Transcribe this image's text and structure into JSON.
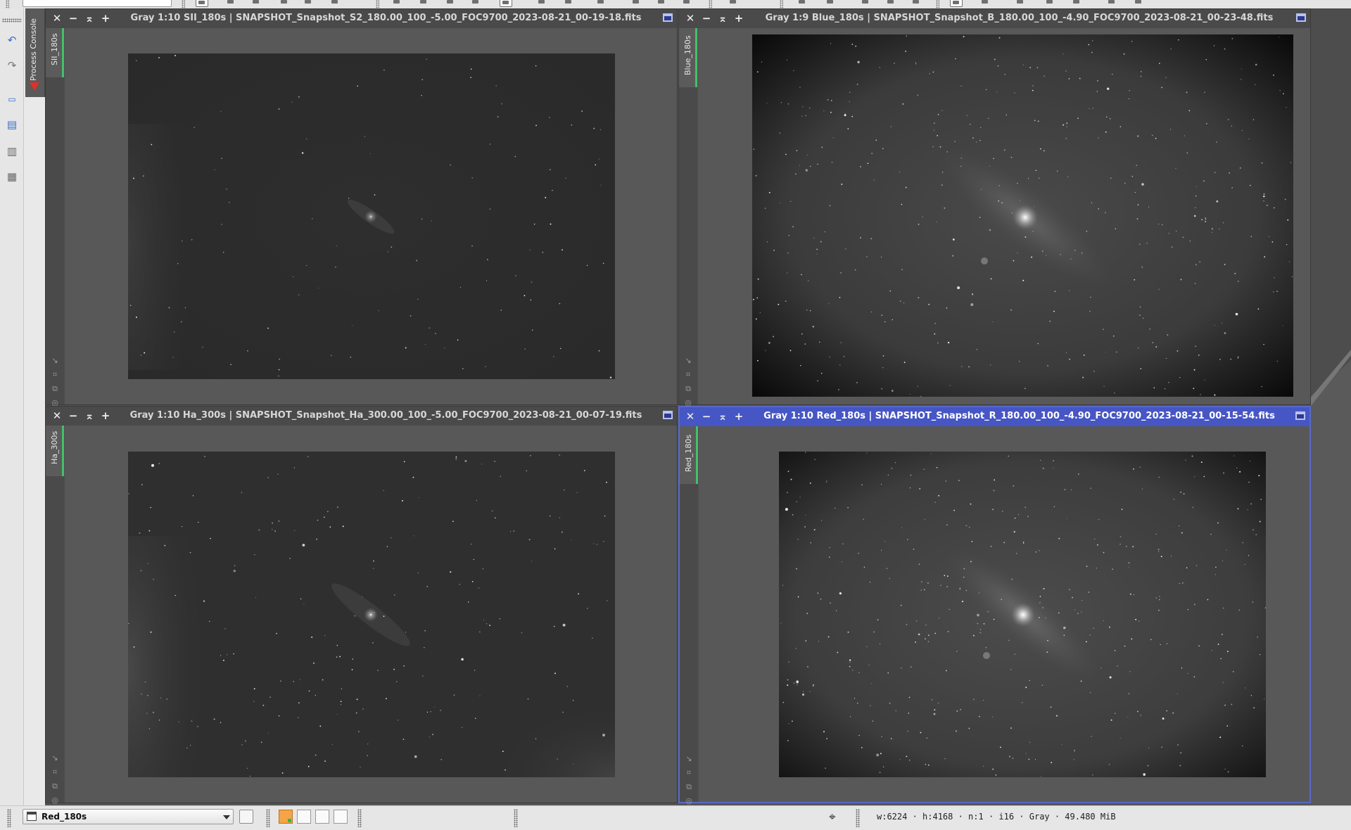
{
  "process_console": {
    "label": "Process Console"
  },
  "statusbar": {
    "view_selector": "Red_180s",
    "info": "w:6224 · h:4168 · n:1 · i16 · Gray · 49.480 MiB"
  },
  "windows": [
    {
      "title": "Gray 1:10 SII_180s | SNAPSHOT_Snapshot_S2_180.00_100_-5.00_FOC9700_2023-08-21_00-19-18.fits",
      "tab": "SII_180s",
      "active": false
    },
    {
      "title": "Gray 1:9 Blue_180s | SNAPSHOT_Snapshot_B_180.00_100_-4.90_FOC9700_2023-08-21_00-23-48.fits",
      "tab": "Blue_180s",
      "active": false
    },
    {
      "title": "Gray 1:10 Ha_300s | SNAPSHOT_Snapshot_Ha_300.00_100_-5.00_FOC9700_2023-08-21_00-07-19.fits",
      "tab": "Ha_300s",
      "active": false
    },
    {
      "title": "Gray 1:10 Red_180s | SNAPSHOT_Snapshot_R_180.00_100_-4.90_FOC9700_2023-08-21_00-15-54.fits",
      "tab": "Red_180s",
      "active": true
    }
  ],
  "window_controls": {
    "close": "✕",
    "minimize": "−",
    "shade": "⌅",
    "add": "+"
  },
  "icons": {
    "undo": "undo-icon",
    "redo": "redo-icon",
    "window_tools": [
      "new-preview-icon",
      "new-window-icon",
      "image-container-icon",
      "extract-icon"
    ],
    "side_tools": [
      "resize-corner-icon",
      "fit-view-icon",
      "clone-icon",
      "target-icon"
    ],
    "statusbar_cursor": "crosshair-icon"
  },
  "colors": {
    "active_title": "#4656c4",
    "active_border": "#5869c9",
    "tab_indicator": "#42c16a",
    "swatch_rgb": "#f5a447"
  }
}
